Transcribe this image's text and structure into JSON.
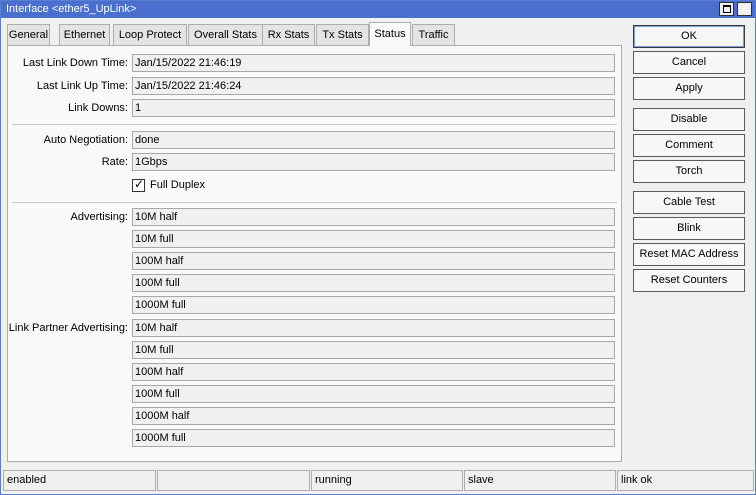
{
  "window": {
    "title": "Interface <ether5_UpLink>"
  },
  "tabs": [
    {
      "label": "General"
    },
    {
      "label": "Ethernet"
    },
    {
      "label": "Loop Protect"
    },
    {
      "label": "Overall Stats"
    },
    {
      "label": "Rx Stats"
    },
    {
      "label": "Tx Stats"
    },
    {
      "label": "Status",
      "active": true
    },
    {
      "label": "Traffic"
    }
  ],
  "status": {
    "last_link_down_time": {
      "label": "Last Link Down Time:",
      "value": "Jan/15/2022 21:46:19"
    },
    "last_link_up_time": {
      "label": "Last Link Up Time:",
      "value": "Jan/15/2022 21:46:24"
    },
    "link_downs": {
      "label": "Link Downs:",
      "value": "1"
    },
    "auto_negotiation": {
      "label": "Auto Negotiation:",
      "value": "done"
    },
    "rate": {
      "label": "Rate:",
      "value": "1Gbps"
    },
    "full_duplex": {
      "label": "Full Duplex",
      "checked": true
    },
    "advertising": {
      "label": "Advertising:",
      "values": [
        "10M half",
        "10M full",
        "100M half",
        "100M full",
        "1000M full"
      ]
    },
    "link_partner_advertising": {
      "label": "Link Partner Advertising:",
      "values": [
        "10M half",
        "10M full",
        "100M half",
        "100M full",
        "1000M half",
        "1000M full"
      ]
    }
  },
  "buttons": {
    "ok": "OK",
    "cancel": "Cancel",
    "apply": "Apply",
    "disable": "Disable",
    "comment": "Comment",
    "torch": "Torch",
    "cable_test": "Cable Test",
    "blink": "Blink",
    "reset_mac": "Reset MAC Address",
    "reset_counters": "Reset Counters"
  },
  "statusbar": [
    "enabled",
    "",
    "running",
    "slave",
    "link ok"
  ],
  "colors": {
    "titlebar": "#4a6fcf",
    "panel": "#f9f9f9",
    "field": "#f0f0f0"
  },
  "icons": {
    "maximize": "maximize-icon",
    "close": "close-icon",
    "check": "checkmark-icon"
  }
}
